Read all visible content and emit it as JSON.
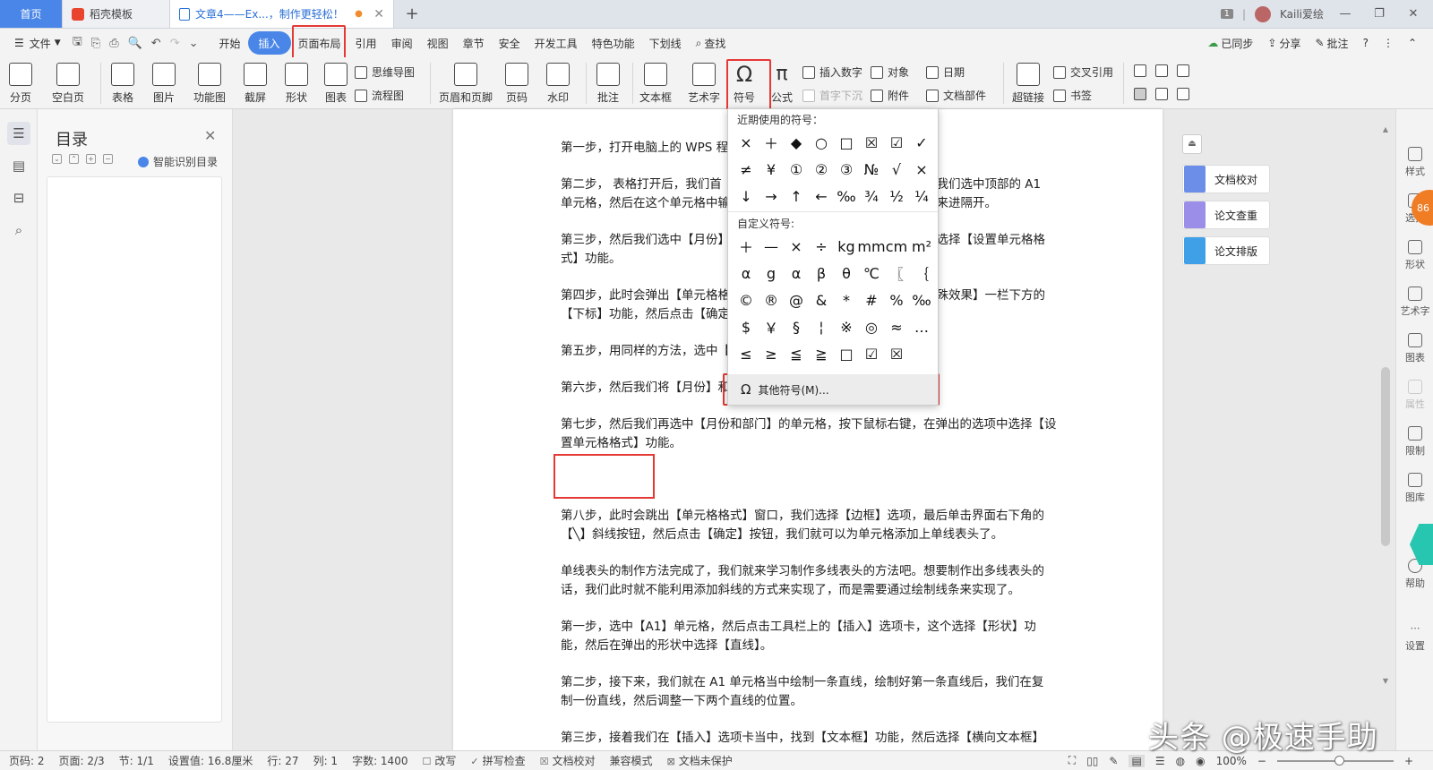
{
  "tabs": {
    "home": "首页",
    "app": "稻壳模板",
    "doc": "文章4——Ex...，制作更轻松！",
    "add": "+"
  },
  "titlebar": {
    "page_count": "1",
    "user": "Kaili爱绘"
  },
  "menu": {
    "file": "文件",
    "items": [
      "开始",
      "插入",
      "页面布局",
      "引用",
      "审阅",
      "视图",
      "章节",
      "安全",
      "开发工具",
      "特色功能",
      "下划线"
    ],
    "search": "查找",
    "sync": "已同步",
    "share": "分享",
    "comment": "批注",
    "help": "?"
  },
  "ribbon": {
    "big": [
      "分页",
      "空白页",
      "表格",
      "图片",
      "功能图",
      "截屏",
      "形状",
      "图表",
      "页眉和页脚",
      "页码",
      "水印",
      "批注",
      "文本框",
      "艺术字",
      "符号",
      "公式",
      "超链接"
    ],
    "small": [
      "思维导图",
      "流程图",
      "插入数字",
      "对象",
      "日期",
      "首字下沉",
      "附件",
      "文档部件",
      "交叉引用",
      "书签"
    ]
  },
  "toc": {
    "title": "目录",
    "smart": "智能识别目录"
  },
  "doc": {
    "paras": [
      "第一步，打开电脑上的 WPS 程",
      "第二步， 表格打开后，我们首",
      "单元格，然后在这个单元格中输",
      "第三步，然后我们选中【月份】",
      "式】功能。",
      "第四步，此时会弹出【单元格格",
      "【下标】功能，然后点击【确定",
      "第五步，用同样的方法，选中【",
      "第六步，然后我们将【月份】和",
      "第七步，然后我们再选中【月份和部门】的单元格，按下鼠标右键，在弹出的选项中选择【设",
      "置单元格格式】功能。",
      "第八步，此时会跳出【单元格格式】窗口，我们选择【边框】选项，最后单击界面右下角的",
      "【╲】斜线按钮，然后点击【确定】按钮，我们就可以为单元格添加上单线表头了。",
      "单线表头的制作方法完成了，我们就来学习制作多线表头的方法吧。想要制作出多线表头的",
      "话，我们此时就不能利用添加斜线的方式来实现了，而是需要通过绘制线条来实现了。",
      "第一步，选中【A1】单元格，然后点击工具栏上的【插入】选项卡，这个选择【形状】功",
      "能，然后在弹出的形状中选择【直线】。",
      "第二步，接下来，我们就在 A1 单元格当中绘制一条直线，绘制好第一条直线后，我们在复",
      "制一份直线，然后调整一下两个直线的位置。",
      "第三步，接着我们在【插入】选项卡当中，找到【文本框】功能，然后选择【横向文本框】"
    ],
    "right_frags": [
      "。",
      "，我们选中顶部的 A1",
      "格来进隔开。",
      "中选择【设置单元格格",
      "特殊效果】一栏下方的"
    ]
  },
  "symbols": {
    "recent_label": "近期使用的符号：",
    "recent": [
      "×",
      "＋",
      "◆",
      "○",
      "□",
      "☒",
      "☑",
      "✓",
      "≠",
      "¥",
      "①",
      "②",
      "③",
      "№",
      "√",
      "×",
      "↓",
      "→",
      "↑",
      "←",
      "‰",
      "¾",
      "½",
      "¼"
    ],
    "custom_label": "自定义符号:",
    "custom": [
      "＋",
      "—",
      "×",
      "÷",
      "kg",
      "mm",
      "cm",
      "m²",
      "α",
      "g",
      "α",
      "β",
      "θ",
      "℃",
      "〖",
      "｛",
      "©",
      "®",
      "@",
      "&",
      "*",
      "#",
      "%",
      "‰",
      "$",
      "￥",
      "§",
      "¦",
      "※",
      "◎",
      "≈",
      "…",
      "≤",
      "≥",
      "≦",
      "≧",
      "□",
      "☑",
      "☒"
    ],
    "more": "其他符号(M)..."
  },
  "right_panel": {
    "proof": "文档校对",
    "check": "论文查重",
    "layout": "论文排版"
  },
  "right_strip": [
    "样式",
    "选择",
    "形状",
    "艺术字",
    "图表",
    "属性",
    "限制",
    "图库",
    "帮助",
    "设置"
  ],
  "orange_badge": "86",
  "status": {
    "pages": "页码: 2",
    "page": "页面: 2/3",
    "section": "节: 1/1",
    "setting": "设置值: 16.8厘米",
    "row": "行: 27",
    "col": "列: 1",
    "words": "字数: 1400",
    "rev": "改写",
    "spell": "拼写检查",
    "proof": "文档校对",
    "compat": "兼容模式",
    "protect": "文档未保护",
    "zoom": "100%"
  },
  "watermark": "头条 @极速手助",
  "colors": {
    "accent": "#4a86e8",
    "highlight": "#e53935"
  }
}
